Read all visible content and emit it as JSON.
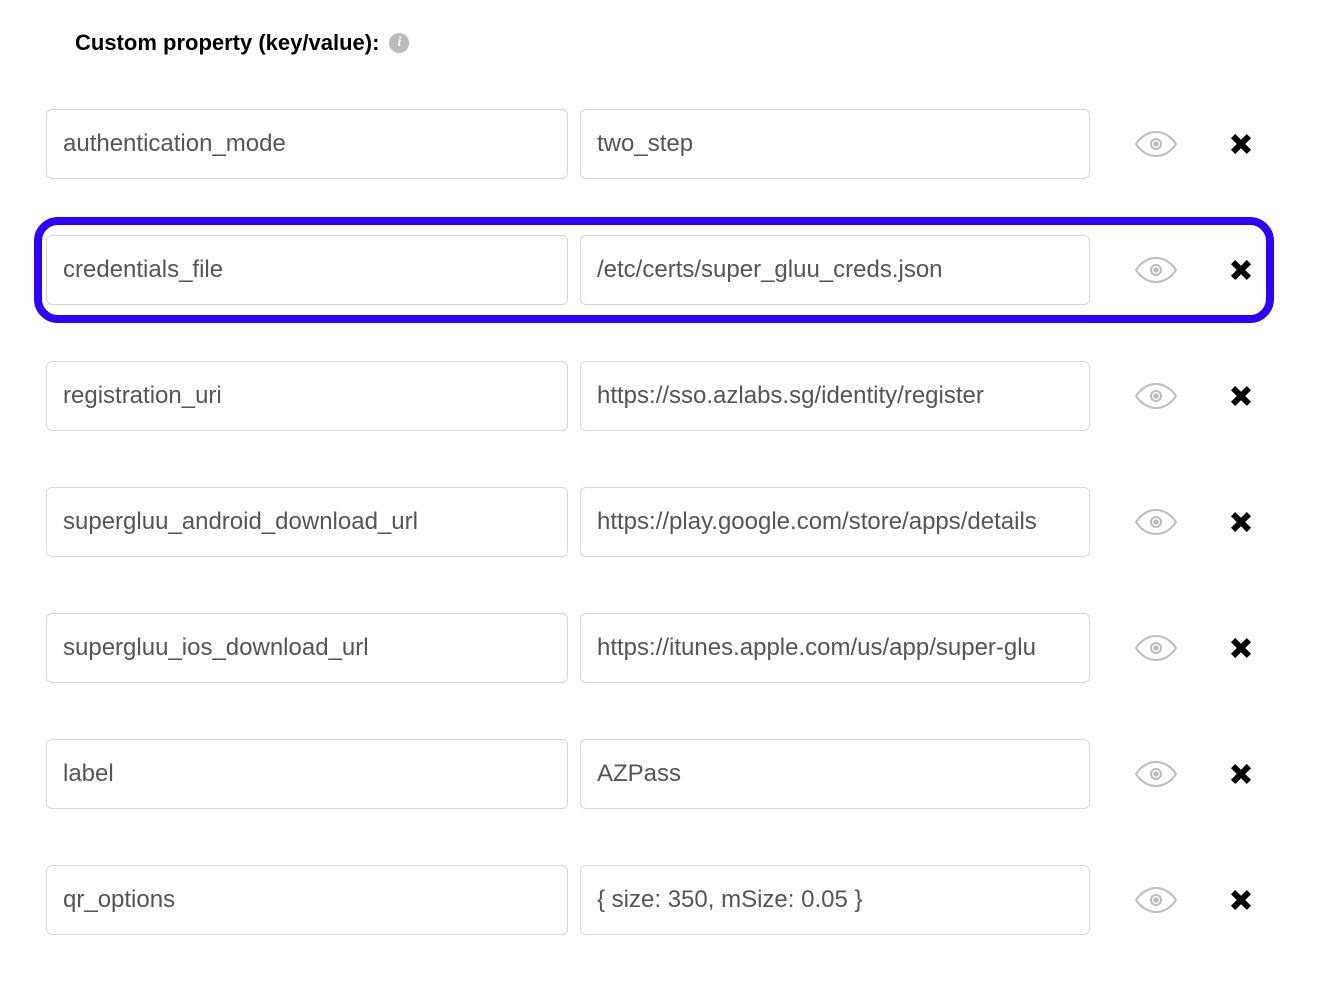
{
  "header": {
    "title": "Custom property (key/value):"
  },
  "rows": [
    {
      "key": "authentication_mode",
      "value": "two_step",
      "highlighted": false
    },
    {
      "key": "credentials_file",
      "value": "/etc/certs/super_gluu_creds.json",
      "highlighted": true
    },
    {
      "key": "registration_uri",
      "value": "https://sso.azlabs.sg/identity/register",
      "highlighted": false
    },
    {
      "key": "supergluu_android_download_url",
      "value": "https://play.google.com/store/apps/details",
      "highlighted": false
    },
    {
      "key": "supergluu_ios_download_url",
      "value": "https://itunes.apple.com/us/app/super-glu",
      "highlighted": false
    },
    {
      "key": "label",
      "value": "AZPass",
      "highlighted": false
    },
    {
      "key": "qr_options",
      "value": "{ size: 350, mSize: 0.05 }",
      "highlighted": false
    }
  ]
}
